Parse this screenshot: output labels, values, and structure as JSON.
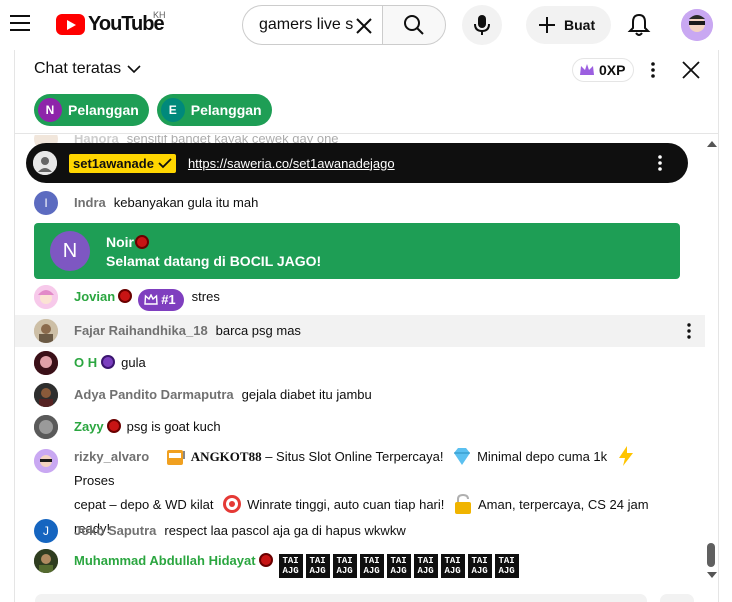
{
  "header": {
    "logo_text": "YouTube",
    "country_code": "KH",
    "search_value": "gamers live s",
    "create_label": "Buat"
  },
  "chat": {
    "mode_label": "Chat teratas",
    "xp_label": "0XP",
    "chips": [
      {
        "initial": "N",
        "label": "Pelanggan",
        "color": "#8e24aa"
      },
      {
        "initial": "E",
        "label": "Pelanggan",
        "color": "#00897b"
      }
    ],
    "faded_message": {
      "author": "Hanora",
      "text": "sensitif banget kayak cewek gay one"
    },
    "pinned": {
      "owner": "set1awanade",
      "link": "https://saweria.co/set1awanadejago"
    },
    "welcome": {
      "initial": "N",
      "name": "Noir",
      "text": "Selamat datang di BOCIL JAGO!"
    },
    "messages": [
      {
        "author": "Indra",
        "initial": "I",
        "avatar_color": "#5c6bc0",
        "text": "kebanyakan gula itu mah"
      },
      {
        "author": "Jovian",
        "rank": "#1",
        "text": "stres"
      },
      {
        "author": "Fajar Raihandhika_18",
        "text": "barca psg mas"
      },
      {
        "author": "O H",
        "text": "gula"
      },
      {
        "author": "Adya Pandito Darmaputra",
        "text": "gejala diabet itu jambu"
      },
      {
        "author": "Zayy",
        "text": "psg is goat kuch"
      },
      {
        "author": "rizky_alvaro",
        "brand": "ANGKOT88",
        "part1": " – Situs Slot Online Terpercaya!",
        "part2": "Minimal depo cuma 1k",
        "part3": "Proses",
        "line2a": "cepat – depo & WD kilat",
        "line2b": "Winrate tinggi, auto cuan tiap hari!",
        "line2c": "Aman, terpercaya, CS 24 jam",
        "line3": "ready!"
      },
      {
        "author": "Joko Saputra",
        "initial": "J",
        "avatar_color": "#1565c0",
        "text": "respect laa pascol aja ga di hapus wkwkw"
      },
      {
        "author": "Muhammad Abdullah Hidayat",
        "tai_top": "TAI",
        "tai_bottom": "AJG"
      }
    ]
  },
  "colors": {
    "member_green": "#2ba640",
    "welcome_green": "#1e9e55",
    "owner_yellow": "#ffd600",
    "rank_purple": "#7f3fbf"
  }
}
